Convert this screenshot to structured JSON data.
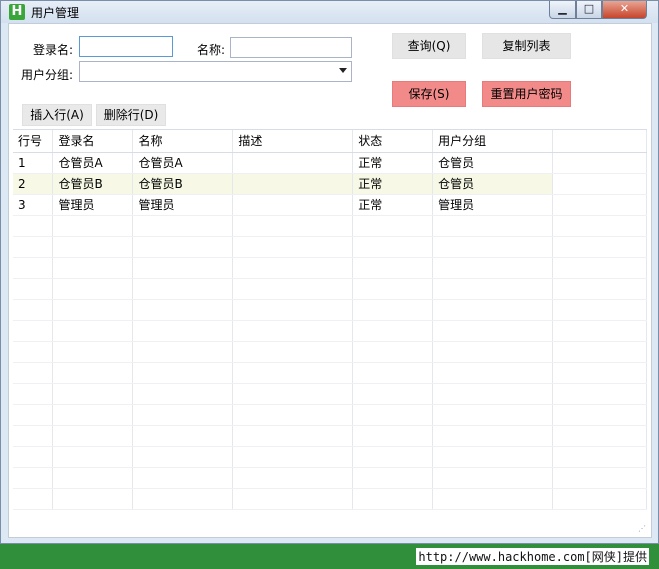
{
  "window": {
    "icon_letter": "H",
    "title": "用户管理",
    "min_glyph": "▁",
    "max_glyph": "□",
    "close_glyph": "✕"
  },
  "search": {
    "login_label": "登录名:",
    "login_value": "",
    "name_label": "名称:",
    "name_value": "",
    "group_label": "用户分组:",
    "group_value": ""
  },
  "buttons": {
    "query": "查询(Q)",
    "copy_list": "复制列表",
    "save": "保存(S)",
    "reset_password": "重置用户密码",
    "insert_row": "插入行(A)",
    "delete_row": "删除行(D)"
  },
  "table": {
    "columns": [
      "行号",
      "登录名",
      "名称",
      "描述",
      "状态",
      "用户分组"
    ],
    "rows": [
      [
        "1",
        "仓管员A",
        "仓管员A",
        "",
        "正常",
        "仓管员"
      ],
      [
        "2",
        "仓管员B",
        "仓管员B",
        "",
        "正常",
        "仓管员"
      ],
      [
        "3",
        "管理员",
        "管理员",
        "",
        "正常",
        "管理员"
      ]
    ]
  },
  "footer": {
    "text": "http://www.hackhome.com[网侠]提供"
  },
  "colors": {
    "accent_red": "#f28a8a",
    "row_highlight": "#f7f9e6",
    "footer_green": "#2f8f3a"
  }
}
